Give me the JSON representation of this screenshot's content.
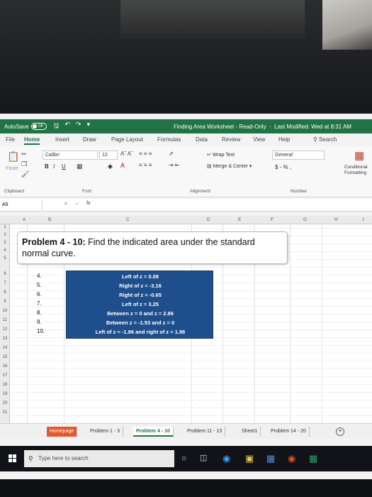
{
  "titlebar": {
    "autosave_label": "AutoSave",
    "autosave_state": "Off",
    "document_title": "Finding Area Worksheet - Read-Only",
    "last_modified": "Last Modified: Wed at 8:31 AM"
  },
  "tabs": [
    "File",
    "Home",
    "Insert",
    "Draw",
    "Page Layout",
    "Formulas",
    "Data",
    "Review",
    "View",
    "Help"
  ],
  "search_label": "Search",
  "ribbon": {
    "paste_label": "Paste",
    "font_name": "Calibri",
    "font_size": "12",
    "bold": "B",
    "italic": "I",
    "underline": "U",
    "wrap_text": "Wrap Text",
    "merge_center": "Merge & Center",
    "number_format": "General",
    "number_symbols": "$ - % ,",
    "conditional_formatting_1": "Conditional",
    "conditional_formatting_2": "Formatting",
    "groups": {
      "clipboard": "Clipboard",
      "font": "Font",
      "alignment": "Alignment",
      "number": "Number"
    }
  },
  "formula_bar": {
    "name_box": "A5",
    "fx": "fx"
  },
  "columns": [
    "A",
    "B",
    "C",
    "D",
    "E",
    "F",
    "G",
    "H",
    "I"
  ],
  "rows": [
    "1",
    "2",
    "3",
    "4",
    "5",
    "6",
    "7",
    "8",
    "9",
    "10",
    "11",
    "12",
    "13",
    "14",
    "15",
    "16",
    "17",
    "18",
    "19",
    "20",
    "21"
  ],
  "problem": {
    "heading": "Problem 4 - 10:",
    "text": "Find the indicated area under the standard normal curve."
  },
  "questions": [
    {
      "num": "4.",
      "text": "Left of z = 0.08"
    },
    {
      "num": "5.",
      "text": "Right of z = -3.16"
    },
    {
      "num": "6.",
      "text": "Right of z = -0.65"
    },
    {
      "num": "7.",
      "text": "Left of z = 3.25"
    },
    {
      "num": "8.",
      "text": "Between z = 0 and z = 2.86"
    },
    {
      "num": "9.",
      "text": "Between z = -1.53 and z = 0"
    },
    {
      "num": "10.",
      "text": "Left of z = -1.96 and right of z = 1.96"
    }
  ],
  "sheet_tabs": [
    "Homepage",
    "Problem 1 - 3",
    "Problem 4 - 10",
    "Problem 11 - 13",
    "Sheet1",
    "Problem 14 - 20"
  ],
  "taskbar": {
    "search_placeholder": "Type here to search"
  },
  "colors": {
    "excel_green": "#217346",
    "question_box": "#1f4e8c",
    "homepage_tab": "#e05a2a"
  }
}
